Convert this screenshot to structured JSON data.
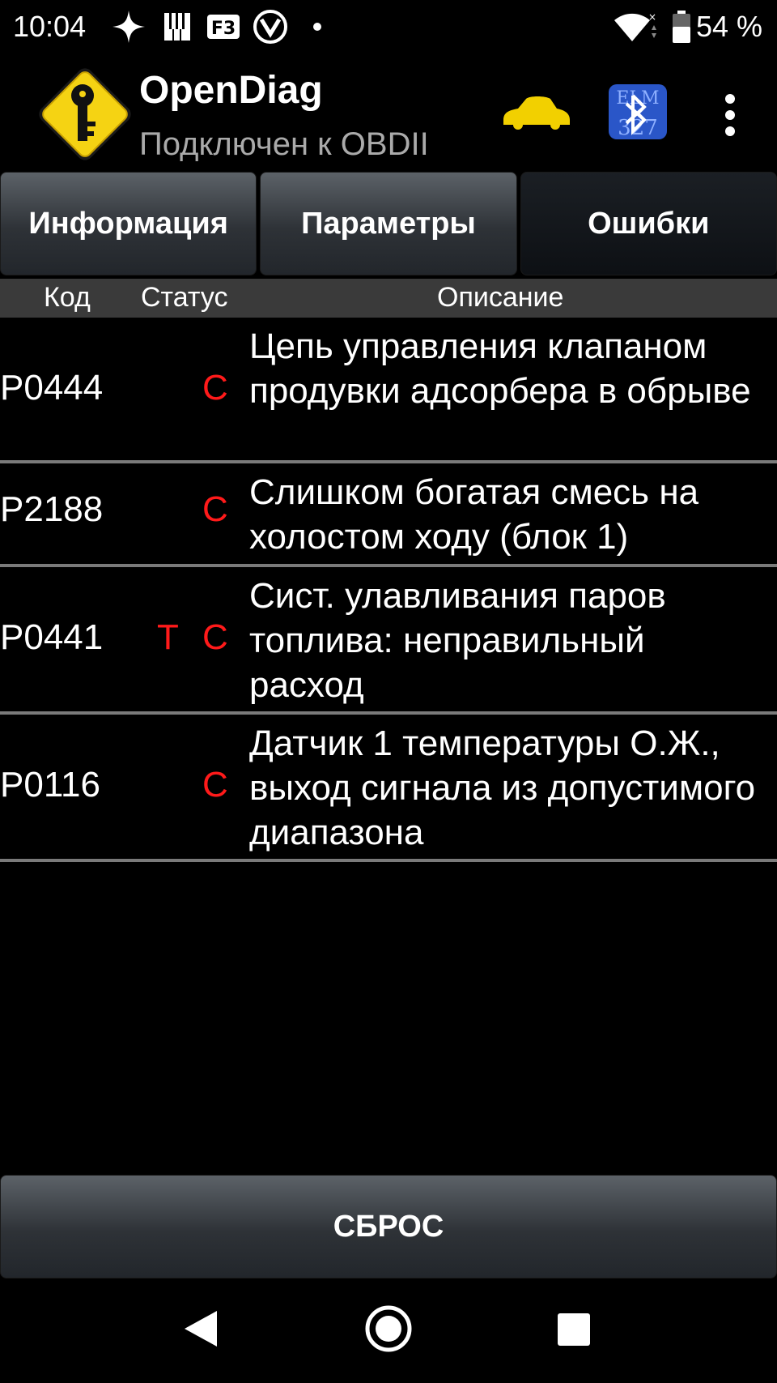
{
  "status_bar": {
    "time": "10:04",
    "battery": "54 %",
    "icons": [
      "sparkle-icon",
      "piano-app-icon",
      "f3-app-icon",
      "v-app-icon",
      "dot-icon",
      "wifi-icon",
      "battery-icon"
    ]
  },
  "app": {
    "title": "OpenDiag",
    "subtitle": "Подключен к OBDII",
    "icons": [
      "key-logo-icon",
      "car-icon",
      "elm327-bluetooth-icon",
      "overflow-menu-icon"
    ]
  },
  "tabs": [
    {
      "label": "Информация",
      "active": false
    },
    {
      "label": "Параметры",
      "active": false
    },
    {
      "label": "Ошибки",
      "active": true
    }
  ],
  "table": {
    "headers": {
      "code": "Код",
      "status": "Статус",
      "description": "Описание"
    },
    "rows": [
      {
        "code": "P0444",
        "status_t": "",
        "status_c": "C",
        "description": "Цепь управления клапаном продувки адсорбера в обрыве"
      },
      {
        "code": "P2188",
        "status_t": "",
        "status_c": "C",
        "description": "Слишком богатая смесь на холостом ходу (блок 1)"
      },
      {
        "code": "P0441",
        "status_t": "T",
        "status_c": "C",
        "description": "Сист. улавливания паров топлива: неправильный расход"
      },
      {
        "code": "P0116",
        "status_t": "",
        "status_c": "C",
        "description": "Датчик 1 температуры О.Ж., выход сигнала из допустимого диапазона"
      }
    ]
  },
  "reset_button": {
    "label": "СБРОС"
  },
  "colors": {
    "status_red": "#ff1a1a",
    "car_yellow": "#f2d000",
    "logo_yellow": "#f5d313",
    "bt_blue": "#2a56c8"
  },
  "nav_bar": {
    "icons": [
      "back-icon",
      "home-icon",
      "recents-icon"
    ]
  }
}
